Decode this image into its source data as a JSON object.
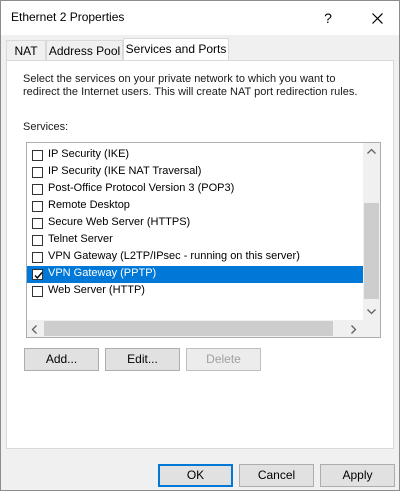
{
  "window": {
    "title": "Ethernet 2 Properties",
    "help_glyph": "?",
    "close_icon": "close-icon"
  },
  "tabs": [
    {
      "label": "NAT",
      "active": false
    },
    {
      "label": "Address Pool",
      "active": false
    },
    {
      "label": "Services and Ports",
      "active": true
    }
  ],
  "panel": {
    "description": "Select the services on your private network to which you want to redirect the Internet users. This will create NAT port redirection rules.",
    "services_label": "Services:",
    "services": [
      {
        "label": "IP Security (IKE)",
        "checked": false,
        "selected": false
      },
      {
        "label": "IP Security (IKE NAT Traversal)",
        "checked": false,
        "selected": false
      },
      {
        "label": "Post-Office Protocol Version 3 (POP3)",
        "checked": false,
        "selected": false
      },
      {
        "label": "Remote Desktop",
        "checked": false,
        "selected": false
      },
      {
        "label": "Secure Web Server (HTTPS)",
        "checked": false,
        "selected": false
      },
      {
        "label": "Telnet Server",
        "checked": false,
        "selected": false
      },
      {
        "label": "VPN Gateway (L2TP/IPsec - running on this server)",
        "checked": false,
        "selected": false
      },
      {
        "label": "VPN Gateway (PPTP)",
        "checked": true,
        "selected": true
      },
      {
        "label": "Web Server (HTTP)",
        "checked": false,
        "selected": false
      }
    ],
    "buttons": {
      "add": "Add...",
      "edit": "Edit...",
      "delete": "Delete"
    }
  },
  "footer": {
    "ok": "OK",
    "cancel": "Cancel",
    "apply": "Apply"
  },
  "colors": {
    "selection": "#0078d7",
    "default_button_border": "#0078d7"
  }
}
